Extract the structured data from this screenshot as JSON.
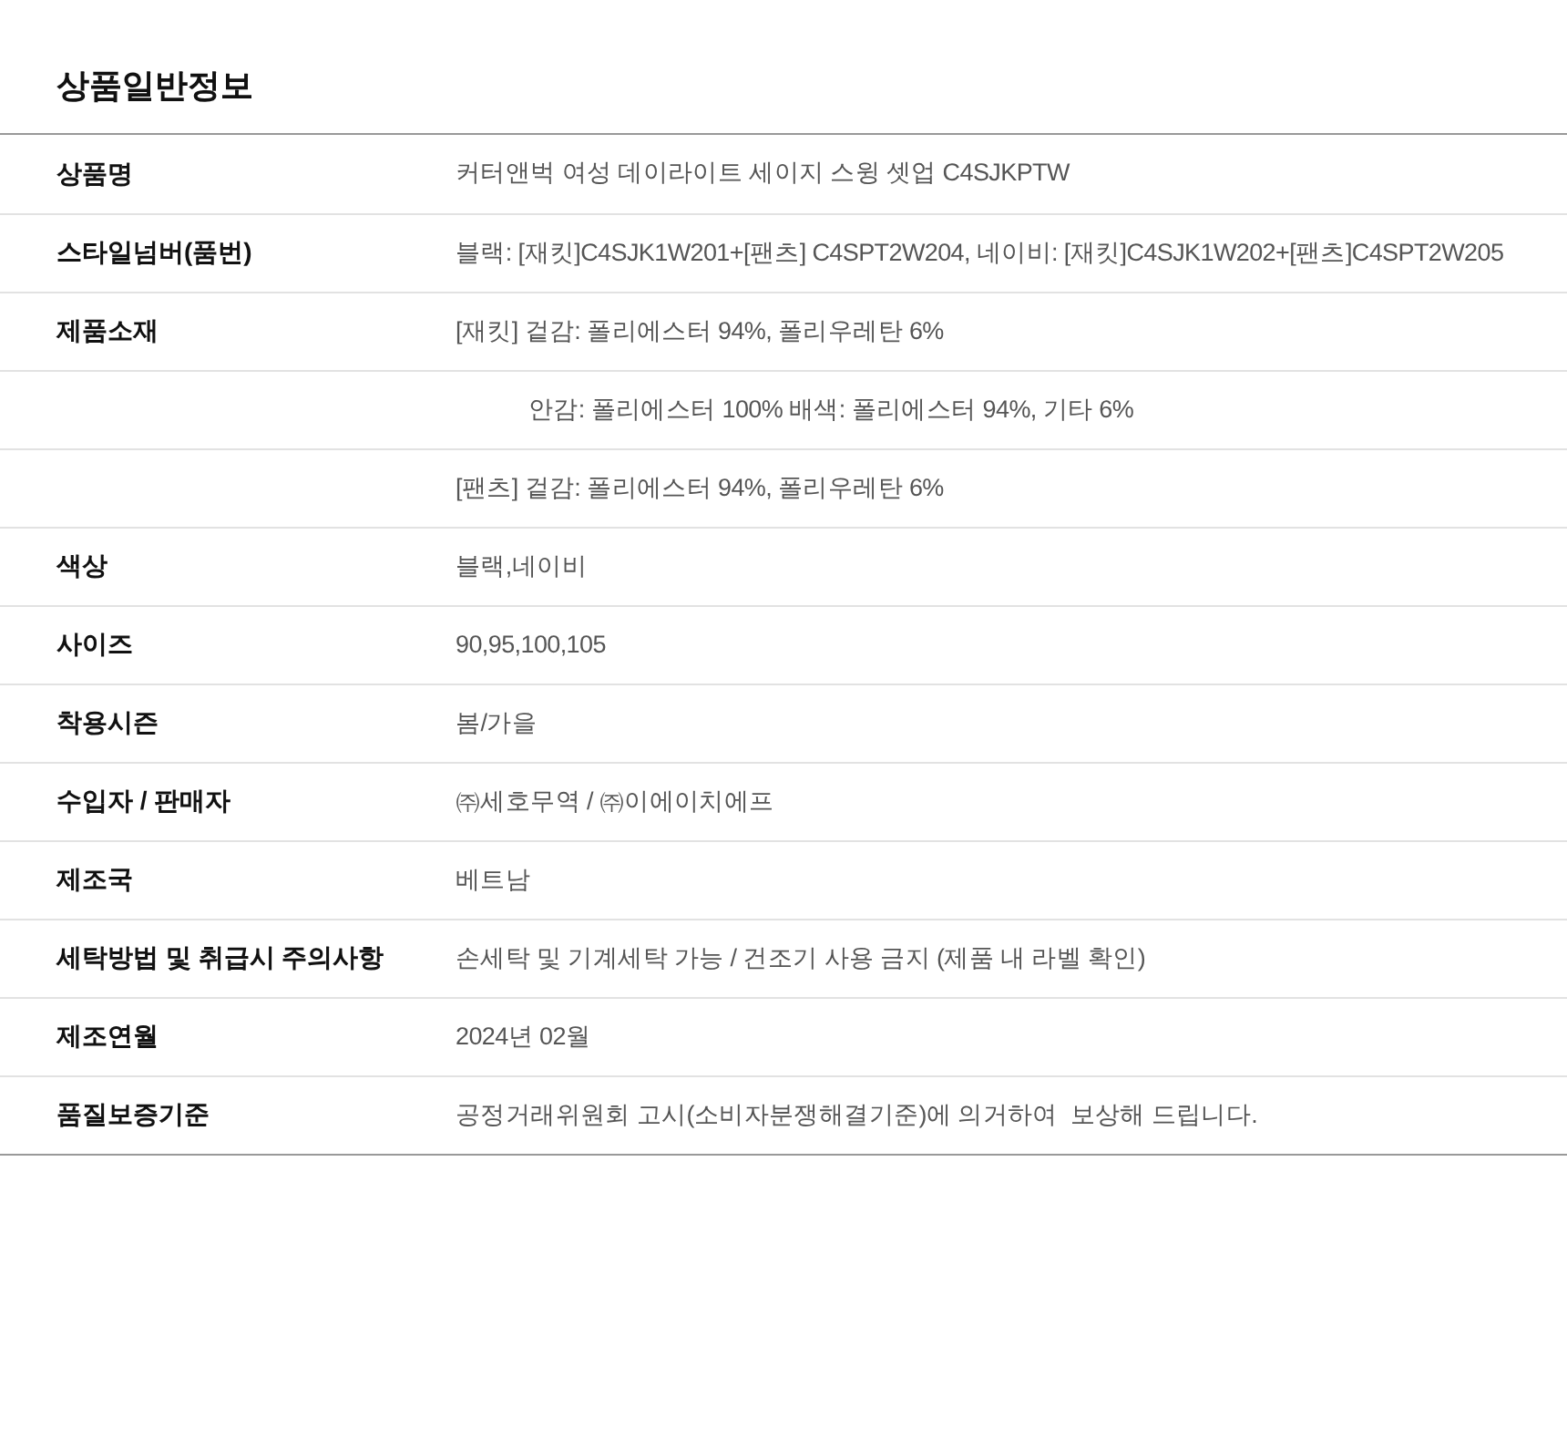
{
  "title": "상품일반정보",
  "rows": [
    {
      "label": "상품명",
      "value": "커터앤벅 여성 데이라이트 세이지 스윙 셋업 C4SJKPTW",
      "indent": false
    },
    {
      "label": "스타일넘버(품번)",
      "value": "블랙: [재킷]C4SJK1W201+[팬츠] C4SPT2W204, 네이비: [재킷]C4SJK1W202+[팬츠]C4SPT2W205",
      "indent": false
    },
    {
      "label": "제품소재",
      "value": "[재킷] 겉감: 폴리에스터 94%, 폴리우레탄 6%",
      "indent": false
    },
    {
      "value": "안감: 폴리에스터 100% 배색: 폴리에스터 94%, 기타 6%",
      "indent": true
    },
    {
      "value": "[팬츠] 겉감: 폴리에스터 94%, 폴리우레탄 6%",
      "indent": false
    },
    {
      "label": "색상",
      "value": "블랙,네이비",
      "indent": false
    },
    {
      "label": "사이즈",
      "value": "90,95,100,105",
      "indent": false
    },
    {
      "label": "착용시즌",
      "value": "봄/가을",
      "indent": false
    },
    {
      "label": "수입자 / 판매자",
      "value": "㈜세호무역 / ㈜이에이치에프",
      "indent": false
    },
    {
      "label": "제조국",
      "value": "베트남",
      "indent": false
    },
    {
      "label": "세탁방법 및 취급시 주의사항",
      "value": "손세탁 및 기계세탁 가능 / 건조기 사용 금지 (제품 내 라벨 확인)",
      "indent": false
    },
    {
      "label": "제조연월",
      "value": "2024년 02월",
      "indent": false
    },
    {
      "label": "품질보증기준",
      "value": "공정거래위원회 고시(소비자분쟁해결기준)에 의거하여  보상해 드립니다.",
      "indent": false
    }
  ]
}
